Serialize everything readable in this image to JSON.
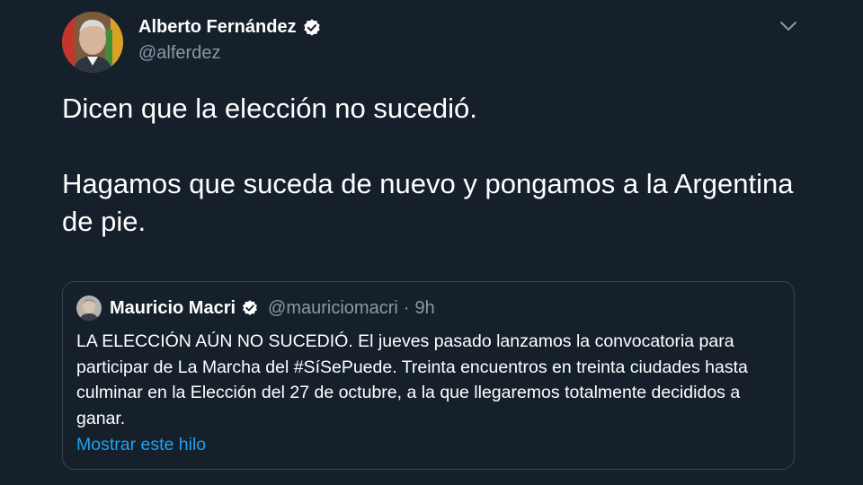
{
  "tweet": {
    "author_name": "Alberto Fernández",
    "author_handle": "@alferdez",
    "text_line1": "Dicen que la elección no sucedió.",
    "text_line2": "Hagamos que suceda de nuevo y pongamos a la Argentina de pie.",
    "caret_icon": "chevron-down-icon",
    "verified_icon": "verified-badge-icon"
  },
  "quote": {
    "author_name": "Mauricio Macri",
    "author_handle": "@mauriciomacri",
    "separator": "·",
    "time": "9h",
    "text": "LA ELECCIÓN AÚN NO SUCEDIÓ. El jueves pasado lanzamos la convocatoria para participar de La Marcha del #SíSePuede. Treinta encuentros en treinta ciudades hasta culminar en la Elección del 27 de octubre, a la que llegaremos totalmente decididos a ganar.",
    "show_thread_label": "Mostrar este hilo"
  },
  "colors": {
    "background": "#15202b",
    "secondary_text": "#8899a6",
    "link": "#1da1f2",
    "border": "#38444d"
  }
}
